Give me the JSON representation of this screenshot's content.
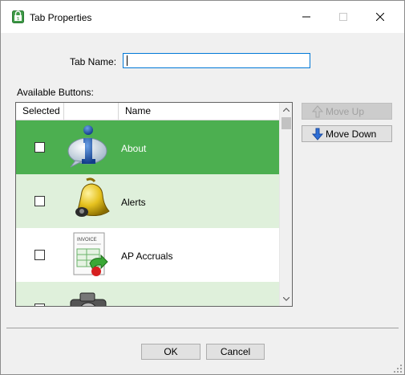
{
  "window": {
    "title": "Tab Properties"
  },
  "form": {
    "tab_name_label": "Tab Name:",
    "tab_name_value": "",
    "available_label": "Available Buttons:"
  },
  "grid": {
    "columns": [
      "Selected",
      "",
      "Name"
    ],
    "rows": [
      {
        "name": "About",
        "checked": false,
        "icon": "info-bubble-icon",
        "selected": true
      },
      {
        "name": "Alerts",
        "checked": false,
        "icon": "bell-icon",
        "selected": false
      },
      {
        "name": "AP Accruals",
        "checked": false,
        "icon": "invoice-icon",
        "selected": false
      },
      {
        "name": "",
        "checked": false,
        "icon": "camera-icon",
        "selected": false
      }
    ]
  },
  "buttons": {
    "move_up": "Move Up",
    "move_down": "Move Down",
    "ok": "OK",
    "cancel": "Cancel"
  },
  "invoice_icon_text": "INVOICE",
  "colors": {
    "selected_row": "#4caf50",
    "alt_row": "#dff0db",
    "focus": "#0078d7"
  }
}
